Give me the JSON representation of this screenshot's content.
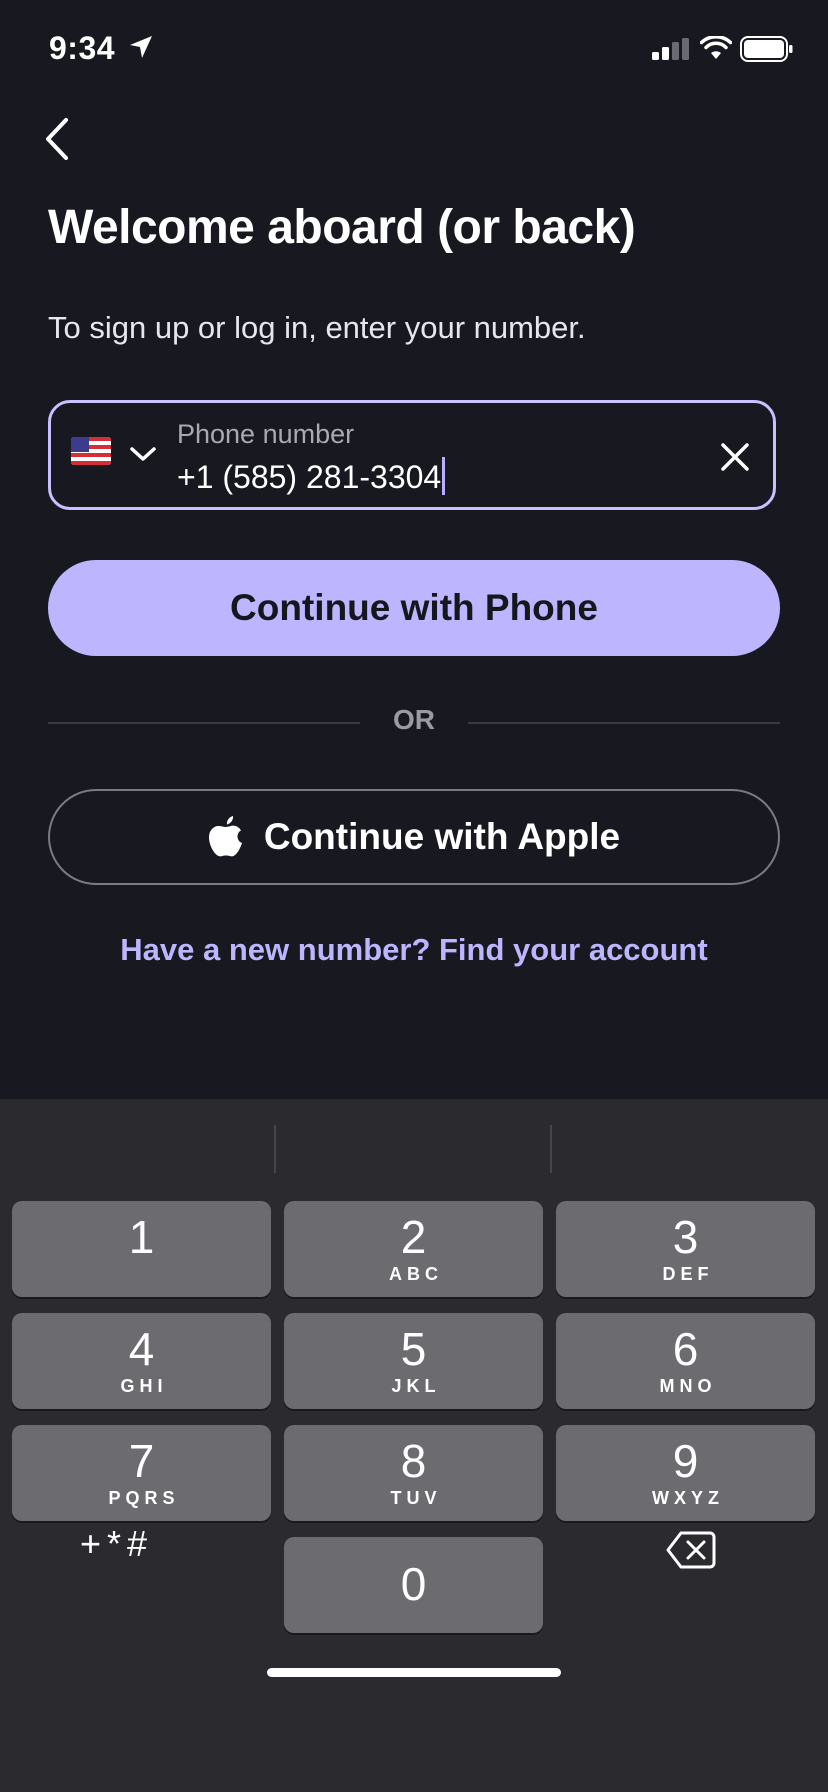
{
  "status_bar": {
    "time": "9:34",
    "icons": [
      "location-arrow-icon",
      "cellular-signal-icon",
      "wifi-icon",
      "battery-icon"
    ]
  },
  "nav": {
    "back_icon": "chevron-left-icon"
  },
  "header": {
    "title": "Welcome aboard (or back)",
    "subtitle": "To sign up or log in, enter your number."
  },
  "phone_field": {
    "country_flag": "us-flag-icon",
    "label": "Phone number",
    "value": "+1 (585) 281-3304",
    "clear_icon": "close-icon"
  },
  "buttons": {
    "continue_phone": "Continue with Phone",
    "divider": "OR",
    "continue_apple": "Continue with Apple",
    "find_account": "Have a new number? Find your account"
  },
  "keyboard": {
    "keys": [
      {
        "num": "1",
        "letters": ""
      },
      {
        "num": "2",
        "letters": "ABC"
      },
      {
        "num": "3",
        "letters": "DEF"
      },
      {
        "num": "4",
        "letters": "GHI"
      },
      {
        "num": "5",
        "letters": "JKL"
      },
      {
        "num": "6",
        "letters": "MNO"
      },
      {
        "num": "7",
        "letters": "PQRS"
      },
      {
        "num": "8",
        "letters": "TUV"
      },
      {
        "num": "9",
        "letters": "WXYZ"
      },
      {
        "num": "0",
        "letters": ""
      }
    ],
    "symbols": "+*#"
  },
  "colors": {
    "background": "#181820",
    "accent": "#bdb6ff",
    "field_border": "#c8c0ff",
    "keyboard_bg": "#2b2b2f",
    "key_bg": "#6c6c70"
  }
}
